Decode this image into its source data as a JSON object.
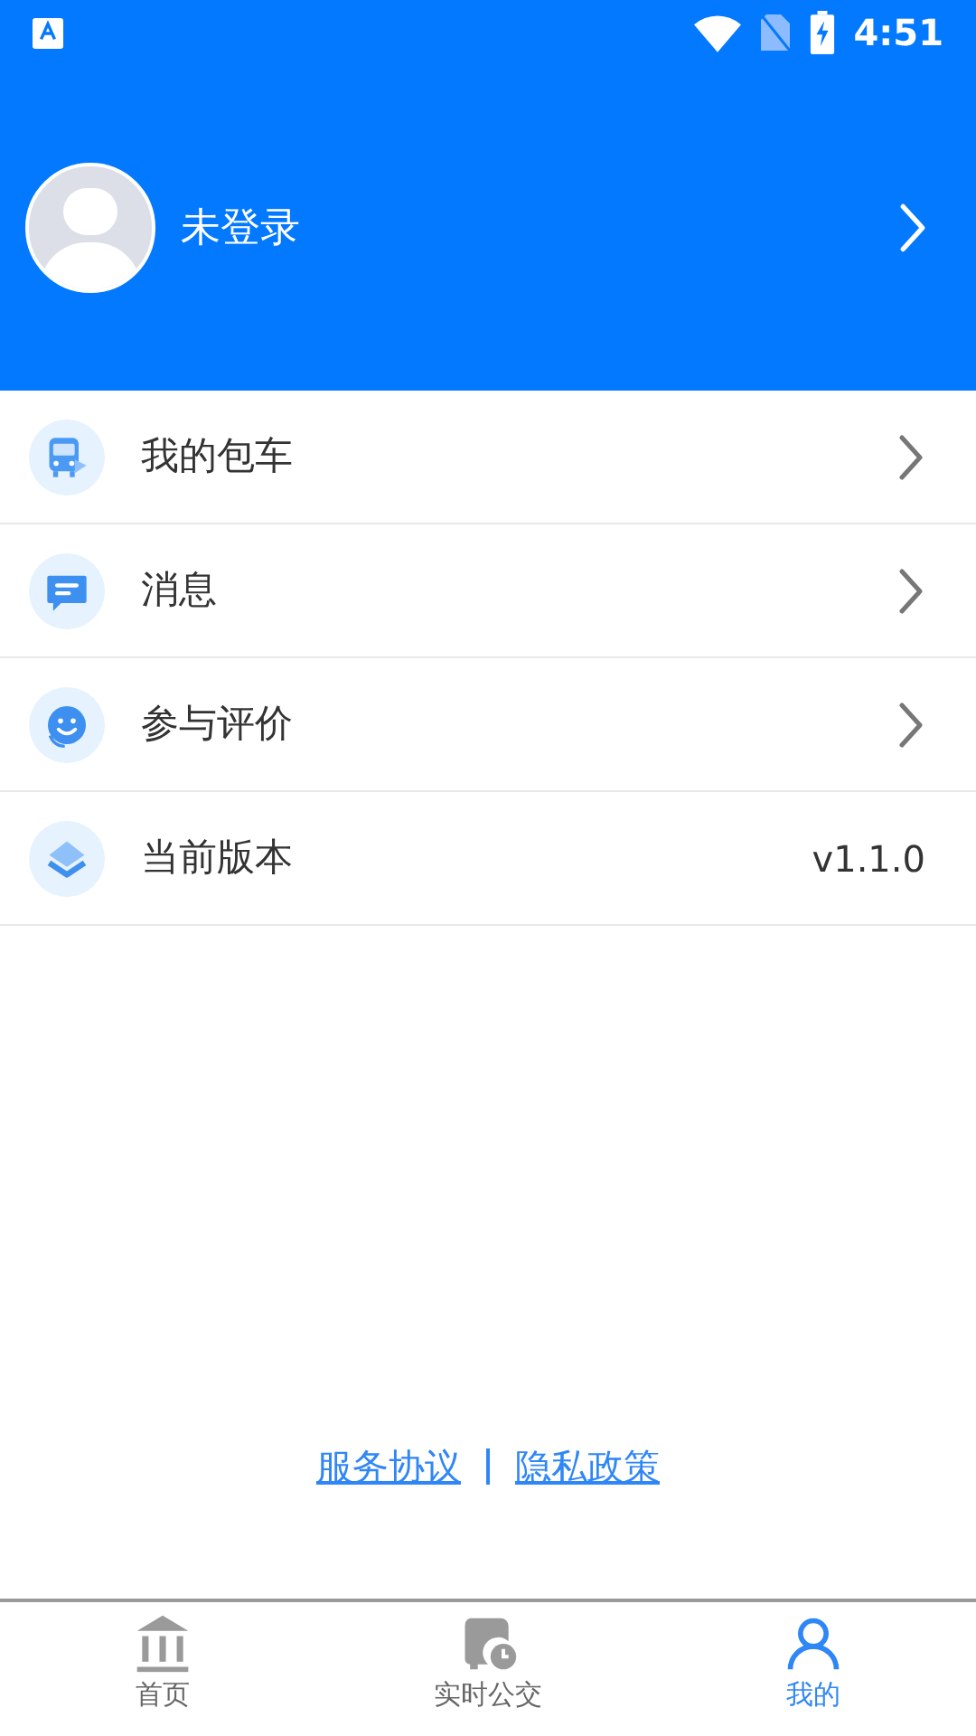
{
  "status_bar": {
    "time": "4:51"
  },
  "profile": {
    "name": "未登录"
  },
  "menu": [
    {
      "label": "我的包车",
      "kind": "arrow"
    },
    {
      "label": "消息",
      "kind": "arrow"
    },
    {
      "label": "参与评价",
      "kind": "arrow"
    },
    {
      "label": "当前版本",
      "kind": "value",
      "value": "v1.1.0"
    }
  ],
  "links": [
    "服务协议",
    "隐私政策"
  ],
  "tabs": [
    {
      "label": "首页",
      "selected": false
    },
    {
      "label": "实时公交",
      "selected": false
    },
    {
      "label": "我的",
      "selected": true
    }
  ]
}
